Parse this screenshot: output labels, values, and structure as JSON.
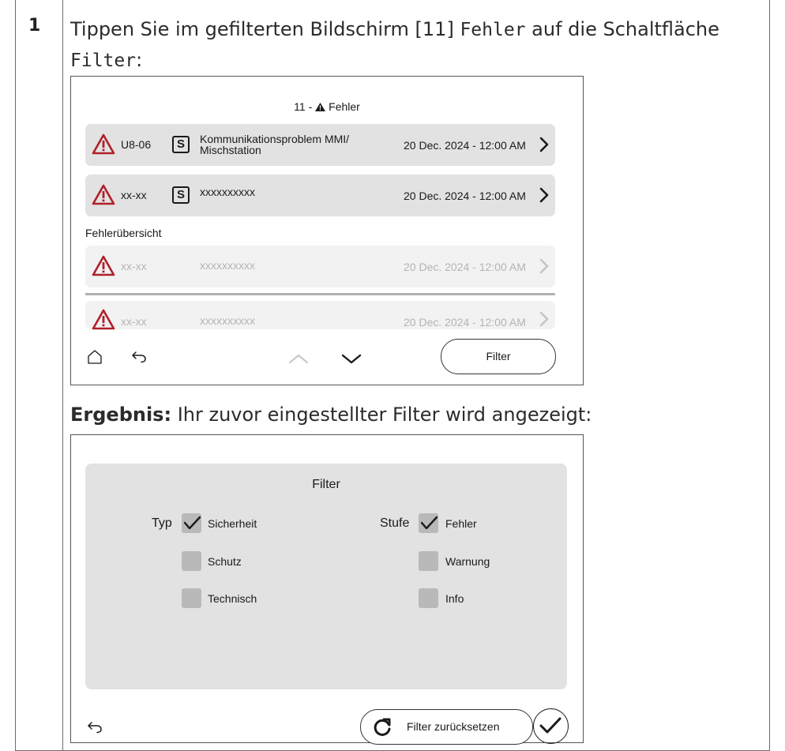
{
  "step": {
    "number": "1",
    "instruction_pre": "Tippen Sie im gefilterten Bildschirm [11] ",
    "instruction_code1": "Fehler",
    "instruction_mid": " auf die Schaltfläche",
    "instruction_code2": "Filter",
    "instruction_post": ":"
  },
  "screen1": {
    "title_prefix": "11 - ",
    "title_name": "Fehler",
    "rows": [
      {
        "code": "U8-06",
        "s": "S",
        "desc_line1": "Kommunikationsproblem MMI/",
        "desc_line2": "Mischstation",
        "time": "20 Dec. 2024 - 12:00 AM"
      },
      {
        "code": "xx-xx",
        "s": "S",
        "desc": "xxxxxxxxxx",
        "time": "20 Dec. 2024 - 12:00 AM"
      }
    ],
    "section_label": "Fehlerübersicht",
    "history_rows": [
      {
        "code": "xx-xx",
        "desc": "xxxxxxxxxx",
        "time": "20 Dec. 2024 - 12:00 AM"
      },
      {
        "code": "xx-xx",
        "desc": "xxxxxxxxxx",
        "time": "20 Dec. 2024 - 12:00 AM"
      }
    ],
    "filter_button": "Filter",
    "icons": {
      "home": "home-icon",
      "back": "back-icon",
      "up": "chevron-up-icon",
      "down": "chevron-down-icon"
    }
  },
  "result": {
    "label": "Ergebnis:",
    "text": " Ihr zuvor eingestellter Filter wird angezeigt:"
  },
  "screen2": {
    "title": "Filter",
    "type_label": "Typ",
    "level_label": "Stufe",
    "type_options": [
      {
        "label": "Sicherheit",
        "checked": true
      },
      {
        "label": "Schutz",
        "checked": false
      },
      {
        "label": "Technisch",
        "checked": false
      }
    ],
    "level_options": [
      {
        "label": "Fehler",
        "checked": true
      },
      {
        "label": "Warnung",
        "checked": false
      },
      {
        "label": "Info",
        "checked": false
      }
    ],
    "reset_button": "Filter zurücksetzen"
  },
  "colors": {
    "warning_red": "#b0202a",
    "panel_gray": "#e2e2e2",
    "checkbox_gray": "#b9b9b9"
  }
}
